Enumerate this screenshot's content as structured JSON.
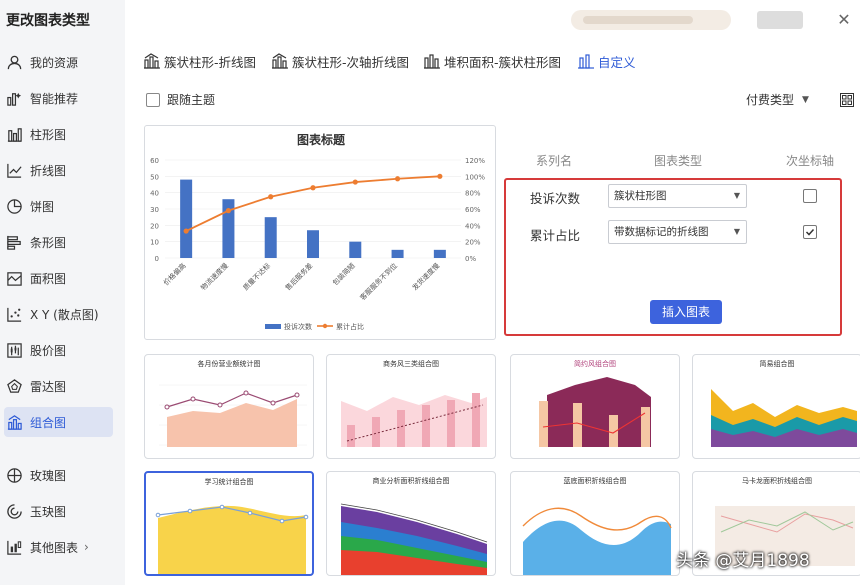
{
  "dialog": {
    "title": "更改图表类型"
  },
  "sidebar": {
    "items": [
      {
        "label": "我的资源",
        "icon": "user-icon"
      },
      {
        "label": "智能推荐",
        "icon": "smart-recommend-icon"
      },
      {
        "label": "柱形图",
        "icon": "column-chart-icon"
      },
      {
        "label": "折线图",
        "icon": "line-chart-icon"
      },
      {
        "label": "饼图",
        "icon": "pie-chart-icon"
      },
      {
        "label": "条形图",
        "icon": "bar-chart-icon"
      },
      {
        "label": "面积图",
        "icon": "area-chart-icon"
      },
      {
        "label": "X Y (散点图)",
        "icon": "scatter-chart-icon"
      },
      {
        "label": "股价图",
        "icon": "stock-chart-icon"
      },
      {
        "label": "雷达图",
        "icon": "radar-chart-icon"
      },
      {
        "label": "组合图",
        "icon": "combo-chart-icon",
        "active": true
      },
      {
        "label": "玫瑰图",
        "icon": "rose-chart-icon"
      },
      {
        "label": "玉玦图",
        "icon": "jade-ring-chart-icon"
      },
      {
        "label": "其他图表",
        "icon": "other-chart-icon",
        "chevron": "›"
      }
    ]
  },
  "tabs": [
    {
      "label": "簇状柱形-折线图"
    },
    {
      "label": "簇状柱形-次轴折线图"
    },
    {
      "label": "堆积面积-簇状柱形图"
    },
    {
      "label": "自定义",
      "active": true
    }
  ],
  "options": {
    "follow_theme": "跟随主题",
    "pay_type": "付费类型"
  },
  "preview": {
    "chart_data": {
      "type": "bar+line",
      "title": "图表标题",
      "categories": [
        "价格偏高",
        "物流速度慢",
        "质量不达标",
        "售后服务差",
        "包装简陋",
        "客服服务不到位",
        "发货速度慢"
      ],
      "series": [
        {
          "name": "投诉次数",
          "type": "bar",
          "axis": "primary",
          "values": [
            48,
            36,
            25,
            17,
            10,
            5,
            5
          ]
        },
        {
          "name": "累计占比",
          "type": "line",
          "axis": "secondary",
          "values": [
            0.33,
            0.58,
            0.75,
            0.86,
            0.93,
            0.97,
            1.0
          ]
        }
      ],
      "y_ticks": [
        "0",
        "10",
        "20",
        "30",
        "40",
        "50",
        "60"
      ],
      "y2_ticks": [
        "0%",
        "20%",
        "40%",
        "60%",
        "80%",
        "100%",
        "120%"
      ],
      "ylim": [
        0,
        60
      ],
      "y2lim": [
        0,
        1.2
      ],
      "legend": "bottom",
      "colors": {
        "bar": "#4472c4",
        "line": "#ed7d31"
      }
    }
  },
  "series_config": {
    "headers": {
      "name": "系列名",
      "type": "图表类型",
      "secondary": "次坐标轴"
    },
    "rows": [
      {
        "name": "投诉次数",
        "type": "簇状柱形图",
        "secondary": false
      },
      {
        "name": "累计占比",
        "type": "带数据标记的折线图",
        "secondary": true
      }
    ],
    "insert_label": "插入图表"
  },
  "thumbnails": [
    {
      "title": "各月份营业额统计图"
    },
    {
      "title": "商务风三类组合图"
    },
    {
      "title": "简约风组合图"
    },
    {
      "title": "简易组合图"
    },
    {
      "title": "学习统计组合图",
      "selected": true
    },
    {
      "title": "商业分析面积折线组合图"
    },
    {
      "title": "蓝底面积折线组合图"
    },
    {
      "title": "马卡龙面积折线组合图"
    }
  ],
  "watermark": "头条 @艾月1898"
}
